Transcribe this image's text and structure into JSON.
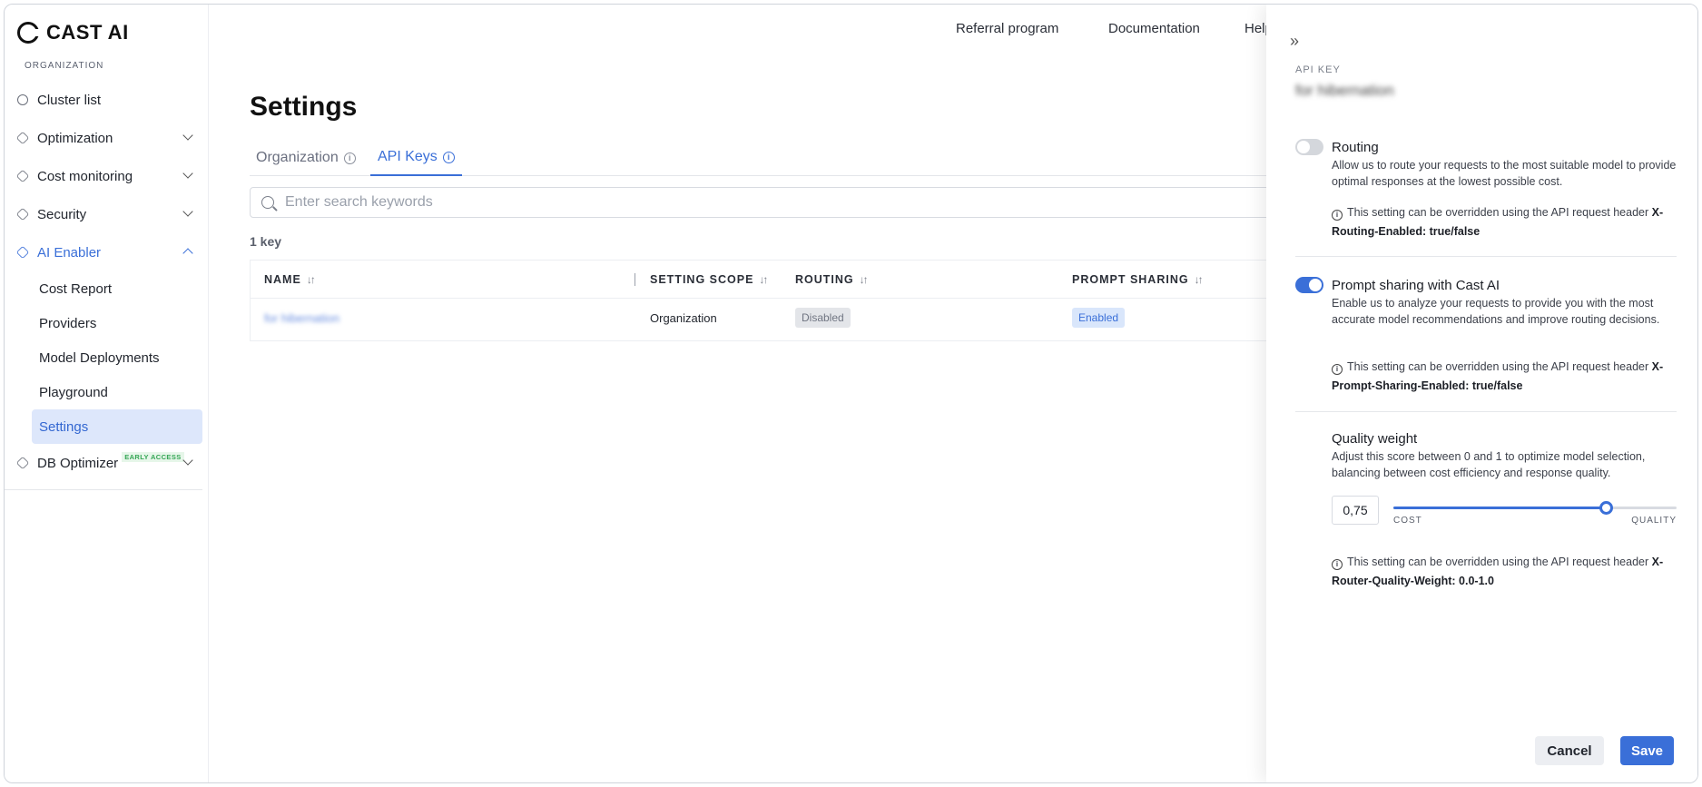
{
  "brand": {
    "logo_text": "CAST AI",
    "accent": "#3a6fd8"
  },
  "sidebar": {
    "org_label": "ORGANIZATION",
    "items": [
      {
        "label": "Cluster list",
        "icon": "hexagon-icon"
      },
      {
        "label": "Optimization",
        "icon": "cube-icon"
      },
      {
        "label": "Cost monitoring",
        "icon": "cube-icon"
      },
      {
        "label": "Security",
        "icon": "cube-icon"
      },
      {
        "label": "AI Enabler",
        "icon": "cube-icon"
      },
      {
        "label": "DB Optimizer",
        "icon": "cube-icon",
        "badge": "EARLY ACCESS"
      }
    ],
    "ai_subitems": [
      {
        "label": "Cost Report"
      },
      {
        "label": "Providers"
      },
      {
        "label": "Model Deployments"
      },
      {
        "label": "Playground"
      },
      {
        "label": "Settings"
      }
    ]
  },
  "topbar": {
    "links": [
      "Referral program",
      "Documentation",
      "Help"
    ]
  },
  "main": {
    "title": "Settings",
    "tabs": [
      {
        "label": "Organization"
      },
      {
        "label": "API Keys"
      }
    ],
    "search_placeholder": "Enter search keywords",
    "count": "1 key",
    "table": {
      "headers": [
        "NAME",
        "SETTING SCOPE",
        "ROUTING",
        "PROMPT SHARING"
      ],
      "rows": [
        {
          "name": "for hibernation",
          "scope": "Organization",
          "routing": "Disabled",
          "prompt_sharing": "Enabled"
        }
      ]
    }
  },
  "drawer": {
    "api_key_label": "API KEY",
    "api_key_name": "for hibernation",
    "routing": {
      "title": "Routing",
      "enabled": false,
      "desc": "Allow us to route your requests to the most suitable model to provide optimal responses at the lowest possible cost.",
      "note_text": "This setting can be overridden using the API request header",
      "note_header": "X-Routing-Enabled: true/false"
    },
    "prompt_sharing": {
      "title": "Prompt sharing with Cast AI",
      "enabled": true,
      "desc": "Enable us to analyze your requests to provide you with the most accurate model recommendations and improve routing decisions.",
      "note_text": "This setting can be overridden using the API request header",
      "note_header": "X-Prompt-Sharing-Enabled: true/false"
    },
    "quality": {
      "title": "Quality weight",
      "desc": "Adjust this score between 0 and 1 to optimize model selection, balancing between cost efficiency and response quality.",
      "value": "0,75",
      "level": 0.75,
      "left_label": "COST",
      "right_label": "QUALITY",
      "note_text": "This setting can be overridden using the API request header",
      "note_header": "X-Router-Quality-Weight: 0.0-1.0"
    },
    "buttons": {
      "cancel": "Cancel",
      "save": "Save"
    }
  }
}
